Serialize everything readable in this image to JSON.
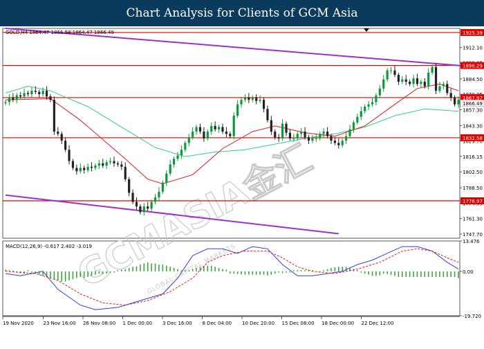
{
  "header": {
    "title": "Chart Analysis for Clients of GCM Asia"
  },
  "chart_data": {
    "type": "candlestick",
    "symbol_line": "GOLD,H4  1864.47 1866.58 1864.47 1866.49",
    "y_ticks": [
      "1912.10",
      "1898.65",
      "1884.50",
      "1870.85",
      "1857.30",
      "1843.30",
      "1829.70",
      "1816.15",
      "1802.50",
      "1788.50",
      "1774.95",
      "1761.30",
      "1747.70"
    ],
    "ylim": [
      1744,
      1929
    ],
    "x_ticks": [
      "19 Nov 2020",
      "23 Nov 16:00",
      "26 Nov 08:00",
      "1 Dec 00:00",
      "3 Dec 16:00",
      "8 Dec 04:00",
      "10 Dec 20:00",
      "15 Dec 08:00",
      "18 Dec 00:00",
      "22 Dec 12:00"
    ],
    "levels": [
      {
        "label": "1925.39",
        "value": 1925.39
      },
      {
        "label": "1896.29",
        "value": 1896.29
      },
      {
        "label": "1867.97",
        "value": 1867.97
      },
      {
        "label": "1832.58",
        "value": 1832.58
      },
      {
        "label": "1776.97",
        "value": 1776.97
      }
    ],
    "current_price": "1866.49",
    "channel": {
      "upper": [
        [
          0,
          1929
        ],
        [
          122,
          1896
        ]
      ],
      "lower": [
        [
          0,
          1782
        ],
        [
          89,
          1748
        ]
      ]
    },
    "candles_close": [
      1864,
      1868,
      1866,
      1870,
      1869,
      1872,
      1871,
      1874,
      1873,
      1871,
      1874,
      1869,
      1866,
      1838,
      1836,
      1830,
      1822,
      1812,
      1806,
      1803,
      1806,
      1804,
      1807,
      1806,
      1808,
      1810,
      1808,
      1811,
      1812,
      1810,
      1809,
      1807,
      1796,
      1784,
      1776,
      1772,
      1767,
      1772,
      1770,
      1776,
      1780,
      1785,
      1793,
      1801,
      1809,
      1814,
      1817,
      1822,
      1828,
      1833,
      1838,
      1842,
      1838,
      1832,
      1838,
      1843,
      1840,
      1842,
      1838,
      1836,
      1834,
      1852,
      1862,
      1866,
      1868,
      1866,
      1868,
      1865,
      1866,
      1858,
      1848,
      1838,
      1833,
      1832,
      1845,
      1837,
      1832,
      1832,
      1836,
      1838,
      1833,
      1830,
      1832,
      1832,
      1836,
      1838,
      1834,
      1830,
      1828,
      1826,
      1830,
      1834,
      1840,
      1846,
      1851,
      1856,
      1860,
      1862,
      1864,
      1870,
      1876,
      1884,
      1892,
      1892,
      1888,
      1882,
      1884,
      1882,
      1880,
      1885,
      1880,
      1882,
      1878,
      1890,
      1895,
      1874,
      1878,
      1880,
      1872,
      1868,
      1862,
      1866
    ],
    "sma_red": [
      [
        0,
        1866
      ],
      [
        12,
        1867
      ],
      [
        20,
        1848
      ],
      [
        32,
        1814
      ],
      [
        38,
        1796
      ],
      [
        42,
        1792
      ],
      [
        50,
        1800
      ],
      [
        58,
        1823
      ],
      [
        66,
        1838
      ],
      [
        72,
        1843
      ],
      [
        80,
        1837
      ],
      [
        88,
        1834
      ],
      [
        96,
        1843
      ],
      [
        104,
        1862
      ],
      [
        110,
        1876
      ],
      [
        116,
        1880
      ],
      [
        121,
        1874
      ]
    ],
    "sma_green": [
      [
        0,
        1872
      ],
      [
        6,
        1878
      ],
      [
        12,
        1874
      ],
      [
        22,
        1860
      ],
      [
        32,
        1840
      ],
      [
        40,
        1824
      ],
      [
        48,
        1816
      ],
      [
        56,
        1820
      ],
      [
        64,
        1822
      ],
      [
        72,
        1827
      ],
      [
        80,
        1832
      ],
      [
        88,
        1836
      ],
      [
        96,
        1842
      ],
      [
        104,
        1852
      ],
      [
        112,
        1858
      ],
      [
        121,
        1856
      ]
    ],
    "macd": {
      "label": "MACD(12,26,9) -0.617 2.402 -3.019",
      "y_ticks": [
        "13.476",
        "0.00",
        "-19.720"
      ],
      "ylim": [
        -19.72,
        13.476
      ],
      "main_line": [
        [
          0,
          -1
        ],
        [
          4,
          -2
        ],
        [
          10,
          0
        ],
        [
          14,
          -8
        ],
        [
          20,
          -15
        ],
        [
          24,
          -17
        ],
        [
          30,
          -16
        ],
        [
          36,
          -13
        ],
        [
          42,
          -10
        ],
        [
          46,
          -3
        ],
        [
          50,
          7
        ],
        [
          54,
          10
        ],
        [
          58,
          10
        ],
        [
          62,
          8
        ],
        [
          66,
          11
        ],
        [
          70,
          10
        ],
        [
          74,
          3
        ],
        [
          78,
          -2
        ],
        [
          82,
          -2
        ],
        [
          86,
          -1
        ],
        [
          90,
          0
        ],
        [
          94,
          3
        ],
        [
          98,
          5
        ],
        [
          102,
          8
        ],
        [
          106,
          11
        ],
        [
          110,
          11
        ],
        [
          114,
          9
        ],
        [
          118,
          4
        ],
        [
          121,
          1
        ]
      ],
      "signal_line": [
        [
          0,
          0
        ],
        [
          8,
          -1
        ],
        [
          14,
          -4
        ],
        [
          20,
          -10
        ],
        [
          26,
          -14
        ],
        [
          32,
          -15
        ],
        [
          38,
          -13
        ],
        [
          44,
          -9
        ],
        [
          50,
          -3
        ],
        [
          54,
          4
        ],
        [
          58,
          7
        ],
        [
          64,
          9
        ],
        [
          70,
          9
        ],
        [
          74,
          6
        ],
        [
          78,
          2
        ],
        [
          82,
          0
        ],
        [
          88,
          -1
        ],
        [
          94,
          1
        ],
        [
          100,
          4
        ],
        [
          106,
          9
        ],
        [
          110,
          10
        ],
        [
          114,
          9
        ],
        [
          118,
          6
        ],
        [
          121,
          4
        ]
      ],
      "histogram": [
        0.8,
        0.5,
        0.3,
        -0.5,
        -0.8,
        -1,
        0.5,
        -0.5,
        -1,
        -1.5,
        -2,
        -2.5,
        -3,
        -3.5,
        -4,
        -4.5,
        -4.5,
        -4,
        -3.5,
        -3,
        -2.5,
        -3,
        -2.5,
        -2,
        -1.5,
        -1,
        -1.2,
        -1,
        -0.8,
        -0.5,
        0.5,
        0.8,
        1,
        1.5,
        2,
        2.2,
        3,
        3.5,
        4,
        3.5,
        3.5,
        3,
        3,
        2.5,
        2,
        1.5,
        1,
        0.5,
        0.5,
        0.5,
        1,
        1.5,
        2,
        2.5,
        2.5,
        2.5,
        2,
        1.5,
        1,
        0.8,
        -1,
        -1,
        -1.2,
        -1.4,
        -1.5,
        -1.5,
        -1.5,
        -1.5,
        -1.5,
        -1.5,
        -1.8,
        -1.5,
        -1,
        -0.5,
        -0.8,
        -0.5,
        -0.5,
        0.5,
        0.5,
        0.5,
        0.5,
        0.5,
        0.5,
        -0.2,
        -0.2,
        0.5,
        1,
        1.5,
        1.8,
        2,
        2,
        2,
        1.5,
        1,
        0.5,
        -0.5,
        -1,
        -1.5,
        -2,
        -2,
        -1.8,
        -1,
        -1.2,
        -1.5,
        -2,
        -2.5,
        -2.5,
        -2.5,
        -2.5,
        -2.5,
        -2.5,
        -2.5,
        -2.5,
        -2.5,
        -2.5,
        -2.5,
        -2.5,
        -2.5,
        -2.5,
        -2.5,
        -2.5,
        -3
      ]
    }
  },
  "watermark": {
    "main": "GCMASIA金汇",
    "sub": "GLOBAL CAPITAL MARKETS"
  },
  "colors": {
    "header_bg": "#0b3b5c",
    "bull": "#0a9a3a",
    "bear": "#222222",
    "level": "#e00000",
    "channel": "#9b2fd6",
    "sma_red": "#e0191a",
    "sma_green": "#2ed08a",
    "macd_main": "#2a3fd8",
    "macd_signal": "#e0191a",
    "macd_hist": "#3aa63a"
  }
}
